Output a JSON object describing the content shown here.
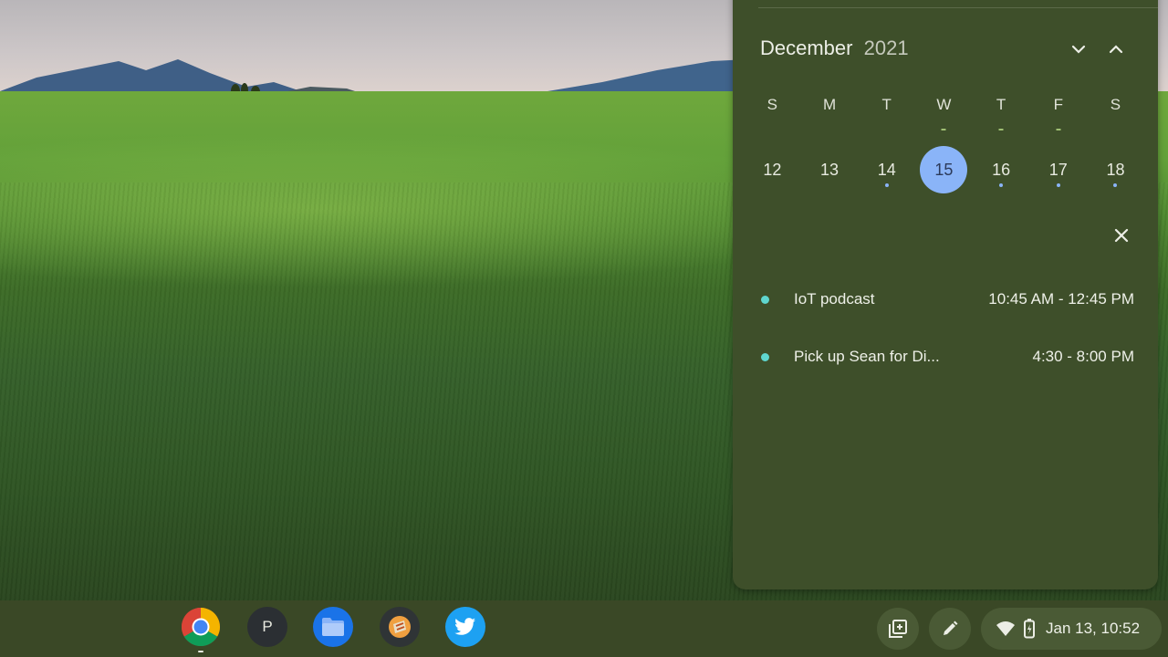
{
  "calendar": {
    "month": "December",
    "year": "2021",
    "weekdays": [
      "S",
      "M",
      "T",
      "W",
      "T",
      "F",
      "S"
    ],
    "dates": [
      "12",
      "13",
      "14",
      "15",
      "16",
      "17",
      "18"
    ],
    "selected_date": "15",
    "nav_next_icon": "chevron-down-icon",
    "nav_prev_icon": "chevron-up-icon",
    "close_icon": "close-icon",
    "accent_color": "#8ab4f8",
    "events": [
      {
        "title": "IoT podcast",
        "time": "10:45 AM - 12:45 PM",
        "color": "#5fd6cf"
      },
      {
        "title": "Pick up Sean for Di...",
        "time": "4:30 - 8:00 PM",
        "color": "#5fd6cf"
      }
    ]
  },
  "shelf": {
    "apps": [
      {
        "name": "Chrome",
        "icon": "chrome-icon"
      },
      {
        "name": "P",
        "icon": "p-app-icon"
      },
      {
        "name": "Files",
        "icon": "files-icon"
      },
      {
        "name": "App",
        "icon": "orange-app-icon"
      },
      {
        "name": "Twitter",
        "icon": "twitter-icon"
      }
    ],
    "tray": {
      "screen_capture_icon": "screen-capture-icon",
      "stylus_icon": "stylus-icon",
      "wifi_icon": "wifi-icon",
      "battery_icon": "battery-icon",
      "datetime": "Jan 13, 10:52"
    }
  }
}
